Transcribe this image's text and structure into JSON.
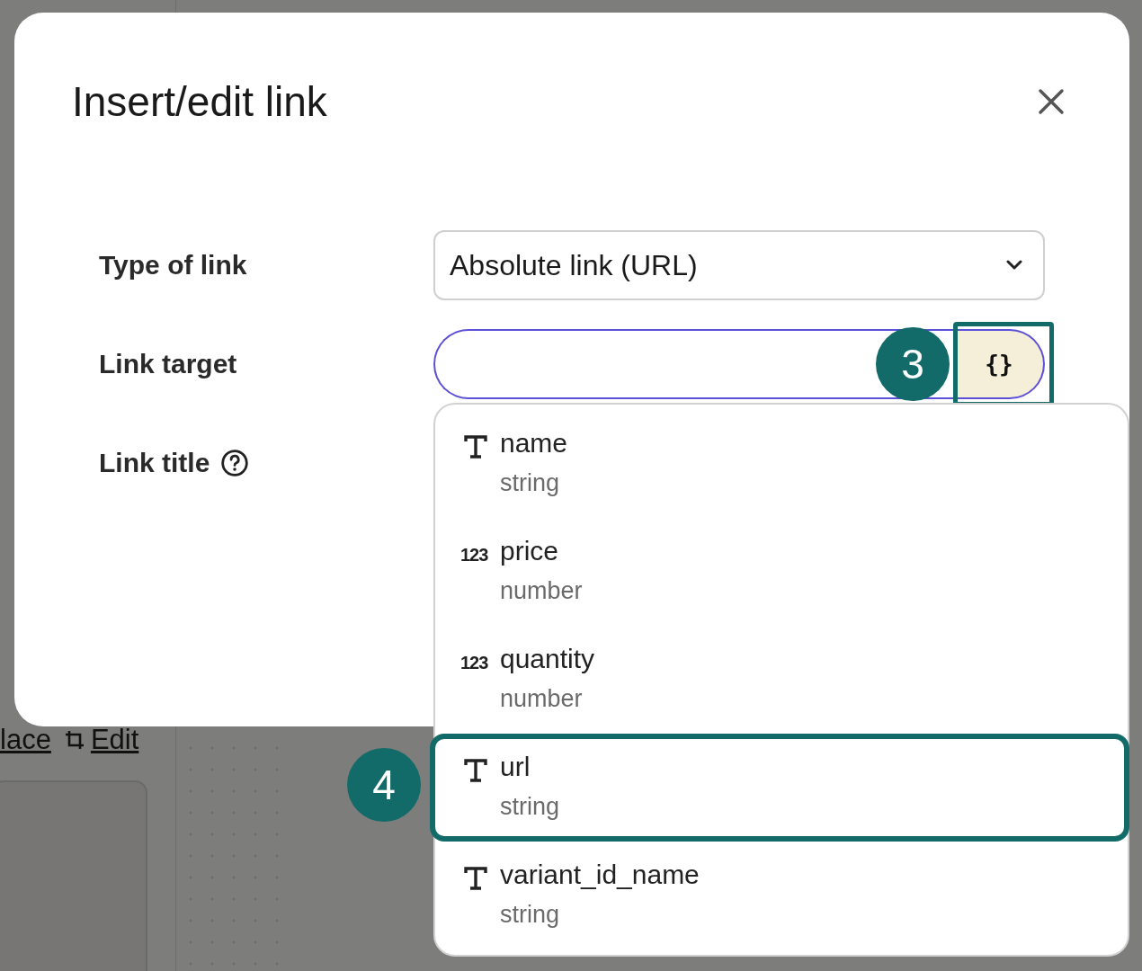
{
  "backdrop": {
    "links": [
      "lace",
      "Edit"
    ]
  },
  "dialog": {
    "title": "Insert/edit link",
    "fields": [
      {
        "label": "Type of link",
        "kind": "select",
        "value": "Absolute link (URL)"
      },
      {
        "label": "Link target",
        "kind": "input",
        "focused": true,
        "button": "{}",
        "callout": "3"
      },
      {
        "label": "Link title",
        "kind": "help"
      }
    ]
  },
  "variables": {
    "callout": "4",
    "items": [
      {
        "name": "name",
        "type": "string",
        "kind": "text",
        "selected": false
      },
      {
        "name": "price",
        "type": "number",
        "kind": "number",
        "icon_text": "123",
        "selected": false
      },
      {
        "name": "quantity",
        "type": "number",
        "kind": "number",
        "icon_text": "123",
        "selected": false
      },
      {
        "name": "url",
        "type": "string",
        "kind": "text",
        "selected": true
      },
      {
        "name": "variant_id_name",
        "type": "string",
        "kind": "text",
        "selected": false
      }
    ]
  }
}
